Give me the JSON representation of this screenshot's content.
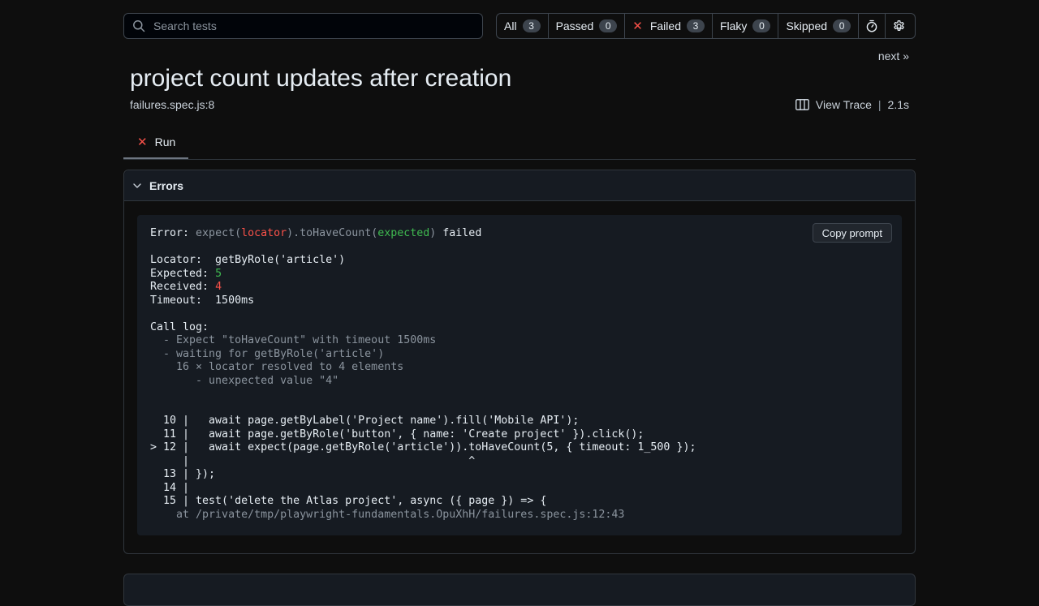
{
  "search": {
    "placeholder": "Search tests",
    "value": ""
  },
  "filters": [
    {
      "label": "All",
      "count": "3"
    },
    {
      "label": "Passed",
      "count": "0"
    },
    {
      "label": "Failed",
      "count": "3"
    },
    {
      "label": "Flaky",
      "count": "0"
    },
    {
      "label": "Skipped",
      "count": "0"
    }
  ],
  "icons": {
    "search": "search-icon",
    "timer": "stopwatch-icon",
    "settings": "gear-icon",
    "failed": "x-icon",
    "trace": "columns-icon",
    "chevron": "chevron-down-icon"
  },
  "nav": {
    "next": "next »"
  },
  "test": {
    "title": "project count updates after creation",
    "location": "failures.spec.js:8",
    "view_trace": "View Trace",
    "separator": "|",
    "duration": "2.1s"
  },
  "tab": {
    "label": "Run"
  },
  "errors": {
    "header": "Errors",
    "copy_button": "Copy prompt",
    "line1": {
      "prefix": "Error: ",
      "expect": "expect(",
      "locator": "locator",
      "method": ").toHaveCount(",
      "expected": "expected",
      "close": ")",
      "suffix": " failed"
    },
    "locator_line": "Locator:  getByRole('article')",
    "expected_label": "Expected: ",
    "expected_value": "5",
    "received_label": "Received: ",
    "received_value": "4",
    "timeout_line": "Timeout:  1500ms",
    "call_log": [
      "Call log:",
      "  - Expect \"toHaveCount\" with timeout 1500ms",
      "  - waiting for getByRole('article')",
      "    16 × locator resolved to 4 elements",
      "       - unexpected value \"4\""
    ],
    "code": [
      "  10 |   await page.getByLabel('Project name').fill('Mobile API');",
      "  11 |   await page.getByRole('button', { name: 'Create project' }).click();",
      "> 12 |   await expect(page.getByRole('article')).toHaveCount(5, { timeout: 1_500 });",
      "     |                                           ^",
      "  13 | });",
      "  14 |",
      "  15 | test('delete the Atlas project', async ({ page }) => {"
    ],
    "stack": "    at /private/tmp/playwright-fundamentals.OpuXhH/failures.spec.js:12:43"
  }
}
